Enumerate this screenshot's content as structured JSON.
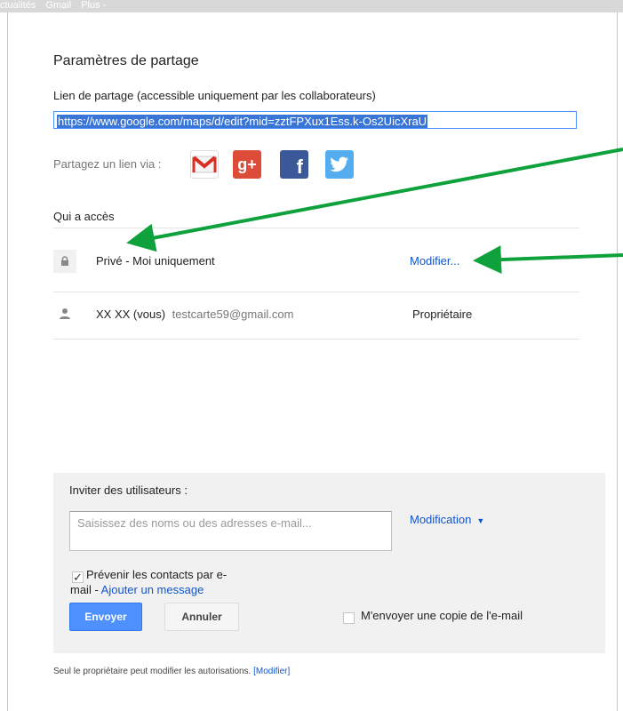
{
  "topbar": {
    "items": [
      "ctualités",
      "Gmail",
      "Plus -"
    ]
  },
  "dialog": {
    "title": "Paramètres de partage",
    "link_label": "Lien de partage (accessible uniquement par les collaborateurs)",
    "link_value": "https://www.google.com/maps/d/edit?mid=zztFPXux1Ess.k-Os2UicXraU",
    "share_via_label": "Partagez un lien via :",
    "share_icons": [
      "gmail-icon",
      "google-plus-icon",
      "facebook-icon",
      "twitter-icon"
    ],
    "access_title": "Qui a accès",
    "access_rows": [
      {
        "icon": "lock-icon",
        "label": "Privé - Moi uniquement",
        "action": "Modifier..."
      },
      {
        "icon": "person-icon",
        "name": "XX XX (vous)",
        "email": "testcarte59@gmail.com",
        "role": "Propriétaire"
      }
    ],
    "invite": {
      "label": "Inviter des utilisateurs :",
      "placeholder": "Saisissez des noms ou des adresses e-mail...",
      "permission": "Modification",
      "notify_label_line1": "Prévenir les contacts par e-",
      "notify_label_line2": "mail - ",
      "add_message": "Ajouter un message",
      "notify_checked": true,
      "send_button": "Envoyer",
      "cancel_button": "Annuler",
      "copy_label": "M'envoyer une copie de l'e-mail",
      "copy_checked": false
    },
    "footer": {
      "text": "Seul le propriétaire peut modifier les autorisations. ",
      "link": "[Modifier]"
    }
  },
  "colors": {
    "accent": "#4d90fe",
    "link": "#1155cc",
    "annotation_arrow": "#0fa23c"
  }
}
